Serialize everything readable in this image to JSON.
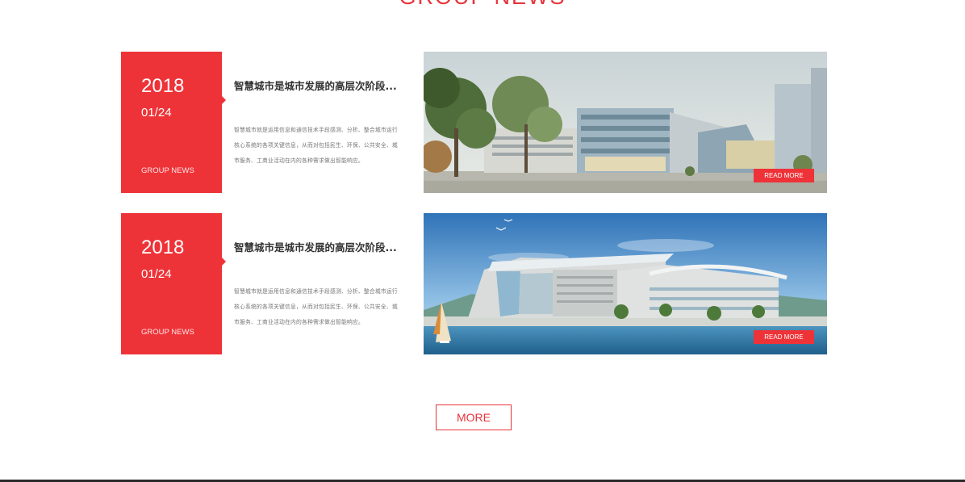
{
  "section": {
    "heading": "GROUP NEWS"
  },
  "colors": {
    "accent": "#ee3338",
    "title_text": "#333333",
    "body_text": "#777777"
  },
  "news": [
    {
      "year": "2018",
      "month_day": "01/24",
      "category": "GROUP NEWS",
      "title": "智慧城市是城市发展的高层次阶段...",
      "summary": "智慧城市就是运用信息和通信技术手段感测、分析、整合城市运行核心系统的各项关键信息，从而对包括民生、环保、公共安全、城市服务、工商业活动在内的各种需求做出智能响应。",
      "read_more": "READ MORE",
      "image": "modern-office-building-photo"
    },
    {
      "year": "2018",
      "month_day": "01/24",
      "category": "GROUP NEWS",
      "title": "智慧城市是城市发展的高层次阶段...",
      "summary": "智慧城市就是运用信息和通信技术手段感测、分析、整合城市运行核心系统的各项关键信息，从而对包括民生、环保、公共安全、城市服务、工商业活动在内的各种需求做出智能响应。",
      "read_more": "READ MORE",
      "image": "waterfront-exhibition-center-photo"
    }
  ],
  "more_button": "MORE"
}
